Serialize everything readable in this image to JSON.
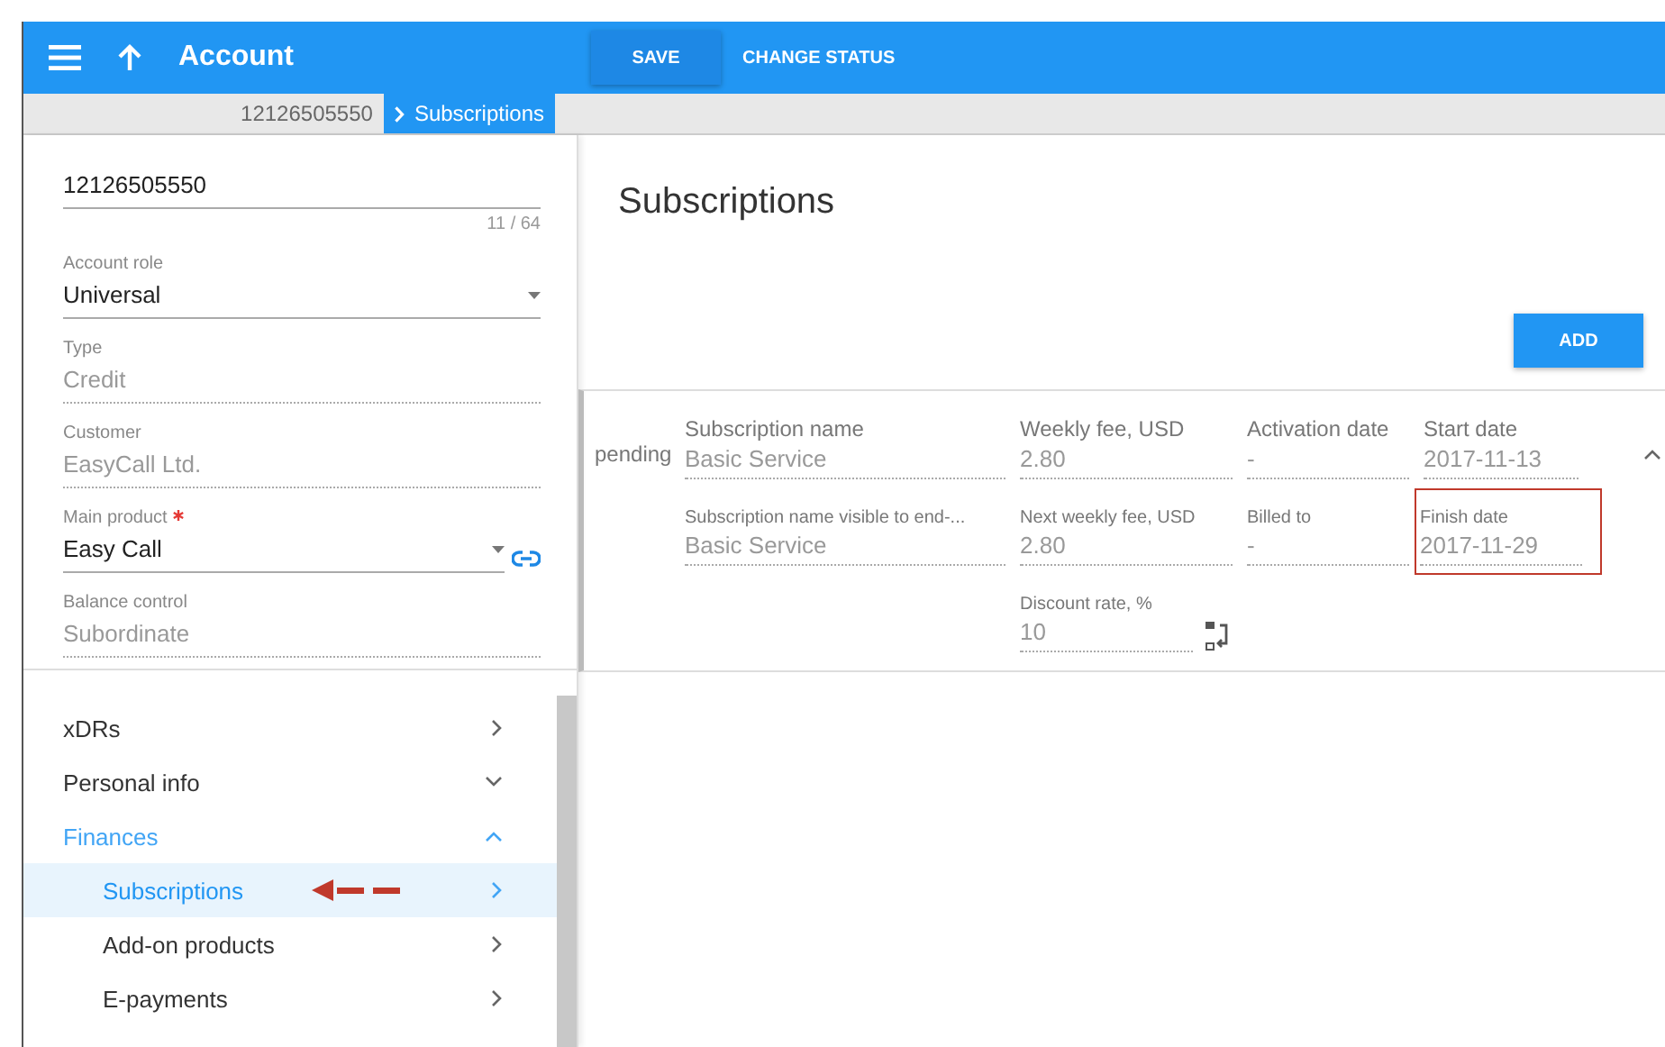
{
  "header": {
    "title": "Account",
    "actions": [
      {
        "label": "SAVE",
        "kind": "raised"
      },
      {
        "label": "CHANGE STATUS",
        "kind": "flat"
      }
    ]
  },
  "breadcrumb": [
    {
      "label": "12126505550",
      "selected": false
    },
    {
      "label": "Subscriptions",
      "selected": true
    }
  ],
  "form": {
    "fields": [
      {
        "kind": "input",
        "value": "12126505550",
        "counter": "11 / 64"
      },
      {
        "kind": "select",
        "label": "Account role",
        "value": "Universal"
      },
      {
        "kind": "readonly",
        "label": "Type",
        "value": "Credit"
      },
      {
        "kind": "readonly",
        "label": "Customer",
        "value": "EasyCall Ltd."
      },
      {
        "kind": "select",
        "label": "Main product",
        "value": "Easy Call",
        "required": true,
        "link": true
      },
      {
        "kind": "readonly",
        "label": "Balance control",
        "value": "Subordinate"
      }
    ]
  },
  "nav": [
    {
      "kind": "link",
      "label": "xDRs"
    },
    {
      "kind": "group",
      "label": "Personal info",
      "expanded": false
    },
    {
      "kind": "group",
      "label": "Finances",
      "expanded": true,
      "children": [
        {
          "label": "Subscriptions",
          "selected": true,
          "annotated": true
        },
        {
          "label": "Add-on products",
          "selected": false,
          "annotated": false
        },
        {
          "label": "E-payments",
          "selected": false,
          "annotated": false
        }
      ]
    }
  ],
  "page": {
    "title": "Subscriptions",
    "add_button": "ADD"
  },
  "subscription": {
    "status": "pending",
    "expanded": true,
    "rows": [
      {
        "kind": "main",
        "fields": [
          {
            "label": "Subscription name",
            "value": "Basic Service",
            "highlighted": false
          },
          {
            "label": "Weekly fee, USD",
            "value": "2.80",
            "highlighted": false
          },
          {
            "label": "Activation date",
            "value": "-",
            "highlighted": false
          },
          {
            "label": "Start date",
            "value": "2017-11-13",
            "highlighted": false
          }
        ]
      },
      {
        "kind": "detail",
        "fields": [
          {
            "label": "Subscription name visible to end-...",
            "value": "Basic Service",
            "highlighted": false
          },
          {
            "label": "Next weekly fee, USD",
            "value": "2.80",
            "highlighted": false
          },
          {
            "label": "Billed to",
            "value": "-",
            "highlighted": false
          },
          {
            "label": "Finish date",
            "value": "2017-11-29",
            "highlighted": true
          }
        ]
      },
      {
        "kind": "extra",
        "fields": [
          {
            "label": "Discount rate, %",
            "value": "10",
            "highlighted": false,
            "swap": true
          }
        ]
      }
    ]
  }
}
